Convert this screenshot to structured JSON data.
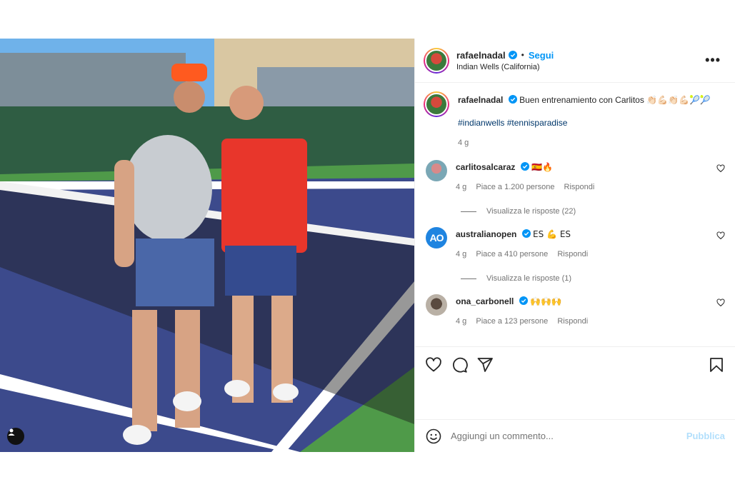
{
  "author": {
    "username": "rafaelnadal",
    "follow_label": "Segui",
    "location": "Indian Wells (California)"
  },
  "caption": {
    "username": "rafaelnadal",
    "text": "Buen entrenamiento con Carlitos",
    "emojis": "👏🏻💪🏻👏🏻💪🏻🎾🎾",
    "hashtags": "#indianwells #tennisparadise",
    "time": "4 g"
  },
  "comments": [
    {
      "username": "carlitosalcaraz",
      "text": "🇪🇸🔥",
      "time": "4 g",
      "likes": "Piace a 1.200 persone",
      "reply": "Rispondi",
      "replies_label": "Visualizza le risposte (22)"
    },
    {
      "username": "australianopen",
      "avatar_text": "AO",
      "text": "ES 💪 ES",
      "time": "4 g",
      "likes": "Piace a 410 persone",
      "reply": "Rispondi",
      "replies_label": "Visualizza le risposte (1)"
    },
    {
      "username": "ona_carbonell",
      "text": "🙌🙌🙌",
      "time": "4 g",
      "likes": "Piace a 123 persone",
      "reply": "Rispondi"
    }
  ],
  "add_comment": {
    "placeholder": "Aggiungi un commento...",
    "publish_label": "Pubblica"
  },
  "colors": {
    "accent": "#0095f6",
    "publish_disabled": "#b2dffc",
    "court_blue": "#3c4a8c",
    "court_green": "#4f9a49",
    "verified": "#0095f6"
  },
  "icons": [
    "more-icon",
    "heart-icon",
    "comment-icon",
    "share-icon",
    "bookmark-icon",
    "emoji-icon",
    "verified-icon",
    "user-tag-icon"
  ]
}
